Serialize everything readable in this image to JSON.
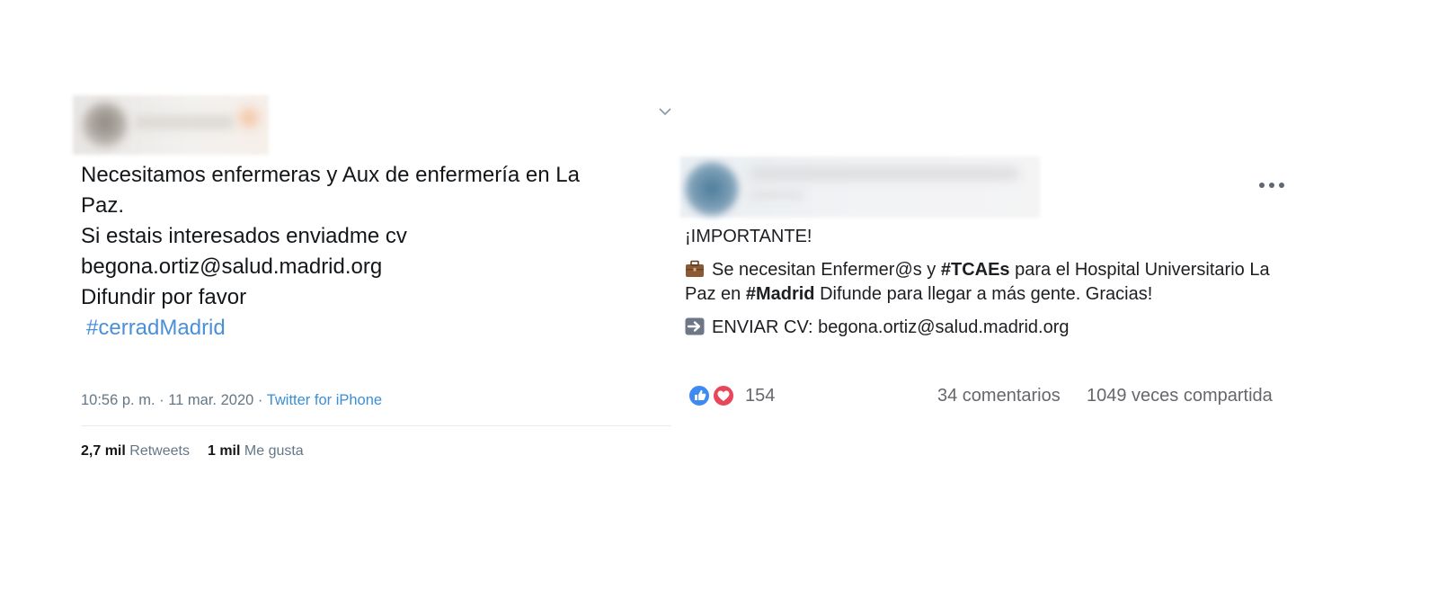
{
  "twitter": {
    "text_lines": [
      "Necesitamos enfermeras y Aux de enfermería en La",
      "Paz.",
      "Si estais interesados enviadme cv",
      "begona.ortiz@salud.madrid.org",
      "",
      "Difundir por favor"
    ],
    "hashtag": "#cerradMadrid",
    "timestamp": "10:56 p. m. · 11 mar. 2020 ·",
    "source": "Twitter for iPhone",
    "retweets_count": "2,7 mil",
    "retweets_label": "Retweets",
    "likes_count": "1 mil",
    "likes_label": "Me gusta",
    "icons": {
      "menu": "chevron-down-icon"
    }
  },
  "facebook": {
    "headline": "¡IMPORTANTE!",
    "para2": {
      "emoji": "briefcase-icon",
      "t1": "Se necesitan Enfermer@s y ",
      "tag1": "#TCAEs",
      "t2": " para el Hospital Universitario La Paz en ",
      "tag2": "#Madrid",
      "t3": " Difunde para llegar a más gente. Gracias!"
    },
    "para3": {
      "emoji": "right-arrow-icon",
      "text": "ENVIAR CV: begona.ortiz@salud.madrid.org"
    },
    "reactions_count": "154",
    "comments": "34 comentarios",
    "shares": "1049 veces compartida",
    "icons": {
      "more": "more-options-icon",
      "like": "like-reaction-icon",
      "love": "love-reaction-icon"
    },
    "colors": {
      "like": "#3d8bf0",
      "love": "#e9455b"
    }
  },
  "colors": {
    "twitter_link": "#3b8fd6",
    "muted": "#657786"
  }
}
